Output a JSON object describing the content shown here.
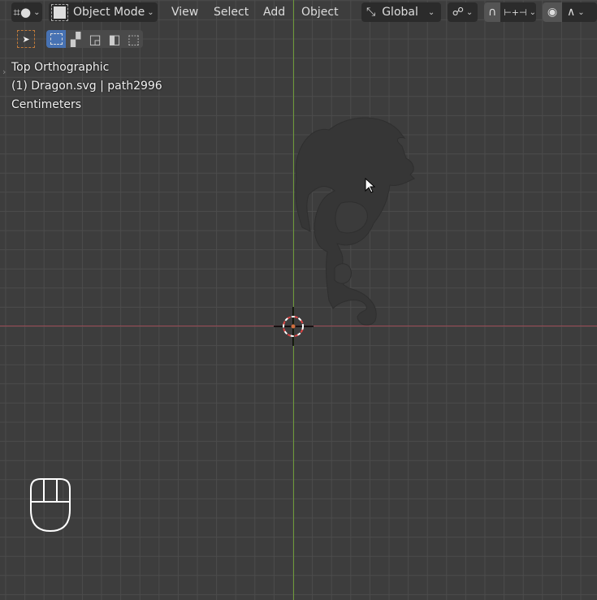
{
  "header": {
    "editor_type_icon": "viewport-grid-icon",
    "mode": "Object Mode",
    "menus": [
      "View",
      "Select",
      "Add",
      "Object"
    ],
    "transform_orientation": "Global",
    "pivot_icon": "pivot-link-icon",
    "snap_icon": "magnet-icon",
    "snap_target_icon": "snap-increment-icon",
    "proportional_icon": "proportional-edit-icon",
    "falloff_icon": "falloff-curve-icon"
  },
  "toolbar": {
    "tool_icon": "select-cursor-icon",
    "select_modes": [
      "new",
      "extend",
      "subtract",
      "invert",
      "intersect"
    ],
    "active_mode": "new"
  },
  "overlay": {
    "view": "Top Orthographic",
    "object": "(1) Dragon.svg | path2996",
    "units": "Centimeters"
  },
  "colors": {
    "x_axis": "#9a4b55",
    "y_axis": "#6e9a3a",
    "background": "#3d3d3d",
    "active": "#4772b3"
  }
}
